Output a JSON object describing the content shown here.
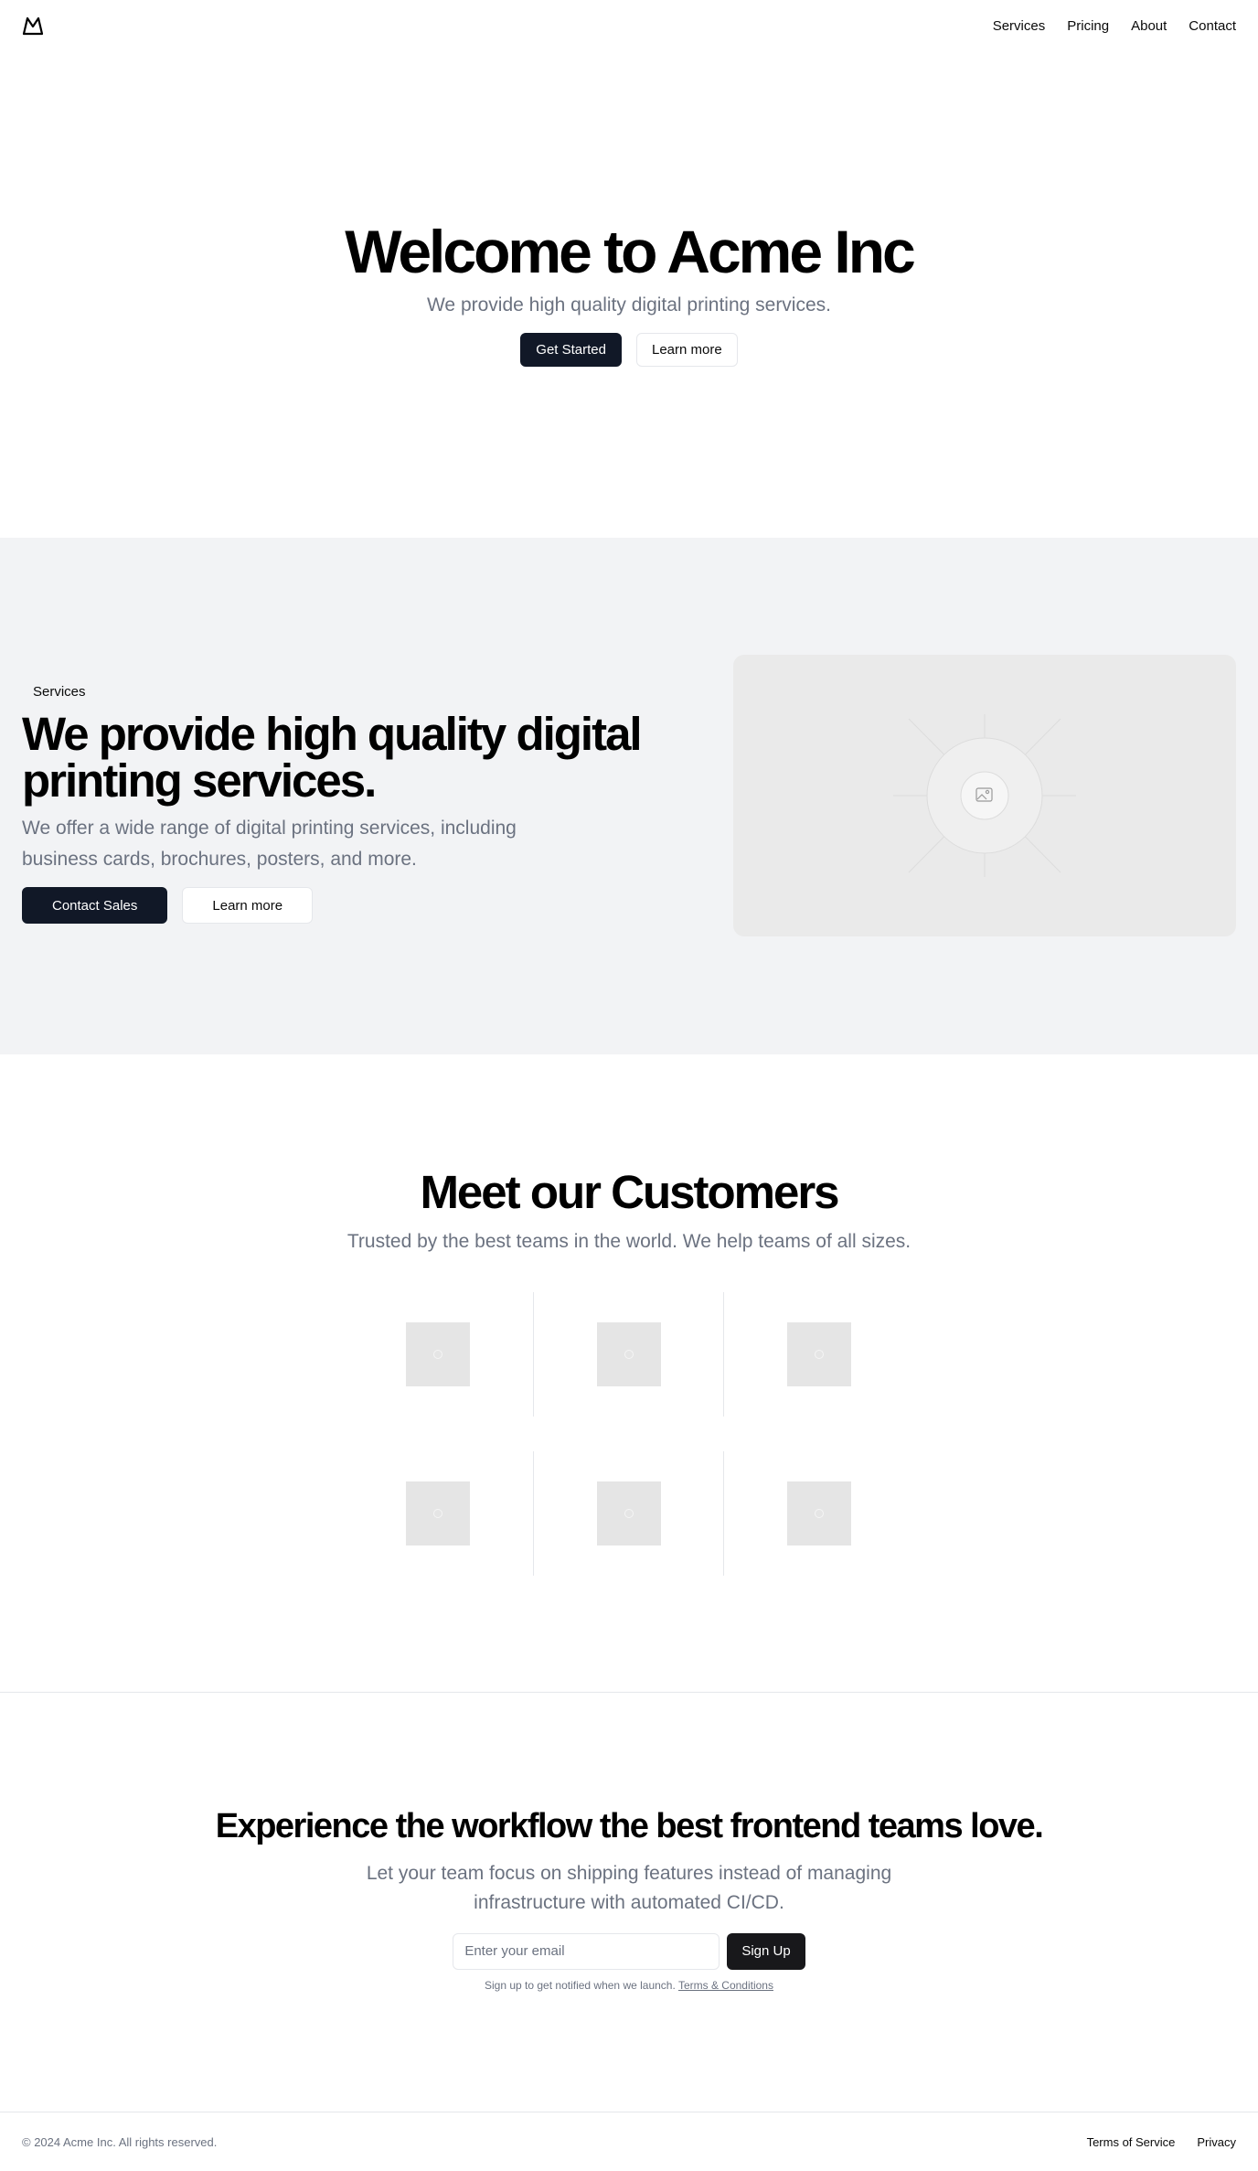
{
  "header": {
    "logo_icon": "mountain-icon",
    "nav": [
      "Services",
      "Pricing",
      "About",
      "Contact"
    ]
  },
  "hero": {
    "title": "Welcome to Acme Inc",
    "subtitle": "We provide high quality digital printing services.",
    "primary_button": "Get Started",
    "secondary_button": "Learn more"
  },
  "services": {
    "badge": "Services",
    "title": "We provide high quality digital printing services.",
    "description": "We offer a wide range of digital printing services, including business cards, brochures, posters, and more.",
    "primary_button": "Contact Sales",
    "secondary_button": "Learn more",
    "image_icon": "image-placeholder-icon"
  },
  "customers": {
    "title": "Meet our Customers",
    "subtitle": "Trusted by the best teams in the world. We help teams of all sizes.",
    "logo_count": 6
  },
  "cta": {
    "title": "Experience the workflow the best frontend teams love.",
    "subtitle": "Let your team focus on shipping features instead of managing infrastructure with automated CI/CD.",
    "email_placeholder": "Enter your email",
    "button": "Sign Up",
    "fine_print": "Sign up to get notified when we launch.",
    "terms_link": "Terms & Conditions"
  },
  "footer": {
    "copyright": "© 2024 Acme Inc. All rights reserved.",
    "links": [
      "Terms of Service",
      "Privacy"
    ]
  },
  "colors": {
    "dark_button": "#111827",
    "muted_text": "#6b7280",
    "section_bg": "#f2f3f5",
    "border": "#e5e7eb"
  }
}
